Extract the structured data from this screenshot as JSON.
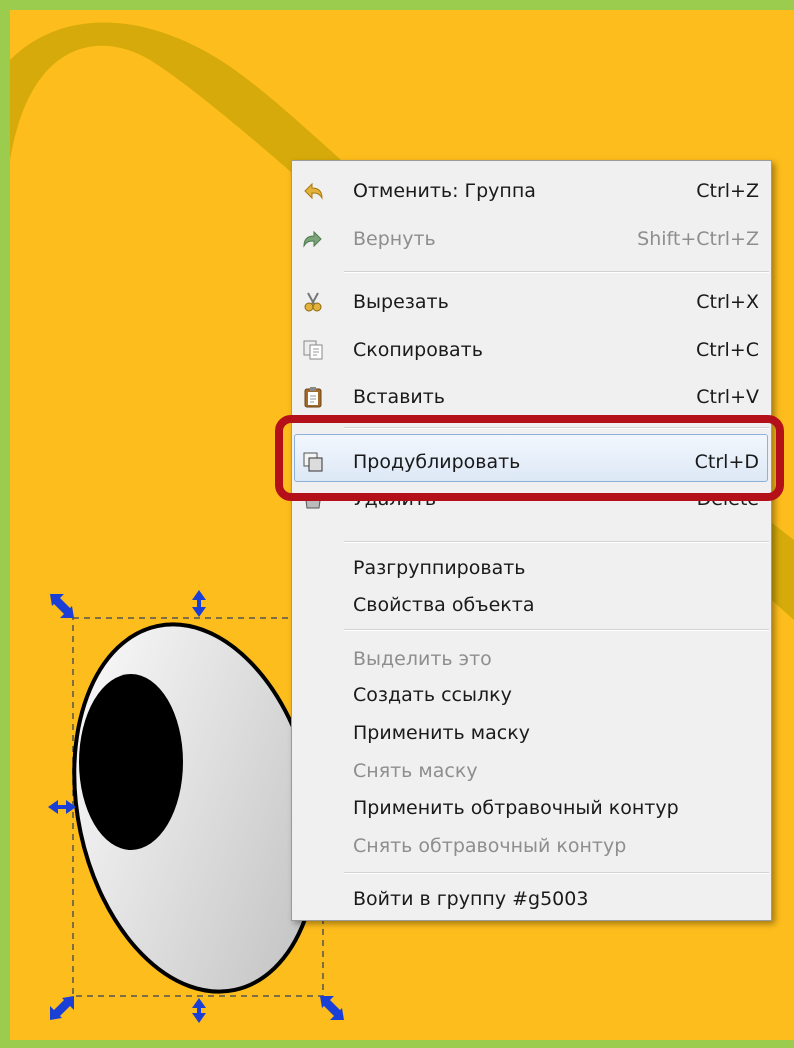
{
  "menu": {
    "items": [
      {
        "label": "Отменить: Группа",
        "shortcut": "Ctrl+Z",
        "icon": "undo-icon",
        "enabled": true
      },
      {
        "label": "Вернуть",
        "shortcut": "Shift+Ctrl+Z",
        "icon": "redo-icon",
        "enabled": false
      },
      {
        "label": "Вырезать",
        "shortcut": "Ctrl+X",
        "icon": "scissors-icon",
        "enabled": true
      },
      {
        "label": "Скопировать",
        "shortcut": "Ctrl+C",
        "icon": "copy-icon",
        "enabled": true
      },
      {
        "label": "Вставить",
        "shortcut": "Ctrl+V",
        "icon": "clipboard-icon",
        "enabled": true
      },
      {
        "label": "Продублировать",
        "shortcut": "Ctrl+D",
        "icon": "duplicate-icon",
        "enabled": true,
        "highlighted": true
      },
      {
        "label": "Удалить",
        "shortcut": "Delete",
        "icon": "trash-icon",
        "enabled": true
      },
      {
        "label": "Разгруппировать",
        "enabled": true
      },
      {
        "label": "Свойства объекта",
        "enabled": true
      },
      {
        "label": "Выделить это",
        "enabled": false
      },
      {
        "label": "Создать ссылку",
        "enabled": true
      },
      {
        "label": "Применить маску",
        "enabled": true
      },
      {
        "label": "Снять маску",
        "enabled": false
      },
      {
        "label": "Применить обтравочный контур",
        "enabled": true
      },
      {
        "label": "Снять обтравочный контур",
        "enabled": false
      },
      {
        "label": "Войти в группу #g5003",
        "enabled": true
      }
    ]
  },
  "colors": {
    "slide_border": "#9ccc4e",
    "background": "#fdbd1c",
    "dark_shape": "#d6aa0a",
    "highlight_box": "#b4101a",
    "selection_handle": "#1a3fd6"
  }
}
